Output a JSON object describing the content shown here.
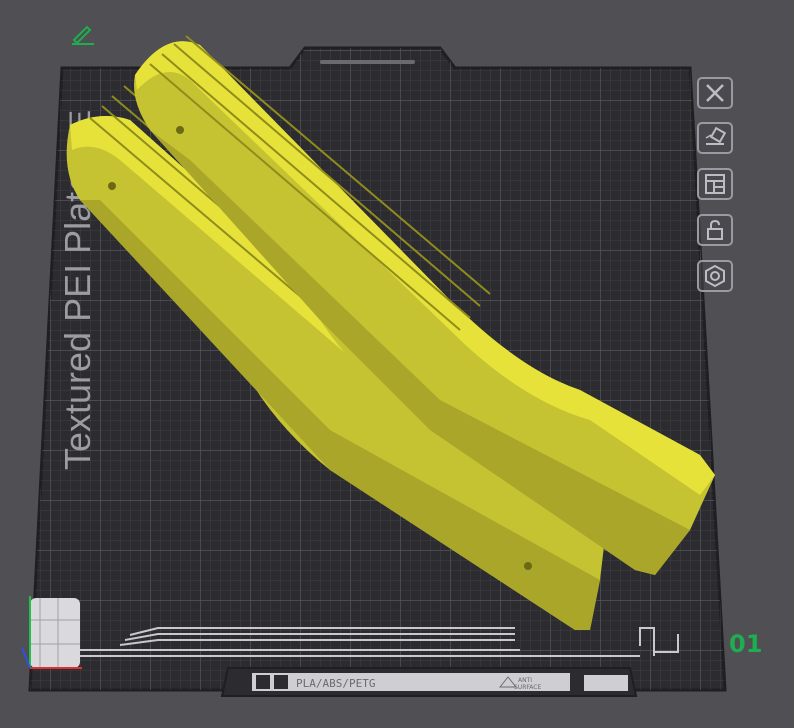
{
  "plate": {
    "name_label": "Textured PEI Plate",
    "name_prefix_cut": "E",
    "name_cut_fragment": "d",
    "material_label": "PLA/ABS/PETG",
    "surface_label_1": "ANTI",
    "surface_label_2": "SURFACE",
    "number": "01"
  },
  "toolbar": {
    "buttons": [
      {
        "name": "close-plate-button",
        "icon": "close-icon"
      },
      {
        "name": "auto-orient-button",
        "icon": "auto-orient-icon"
      },
      {
        "name": "arrange-button",
        "icon": "arrange-icon"
      },
      {
        "name": "lock-button",
        "icon": "unlock-icon"
      },
      {
        "name": "plate-settings-button",
        "icon": "hexagon-nut-icon"
      }
    ]
  },
  "colors": {
    "background": "#4f4f54",
    "plate": "#2a2a2e",
    "grid": "#5a5a60",
    "model": "#e6e23a",
    "accent": "#1fae4f"
  }
}
